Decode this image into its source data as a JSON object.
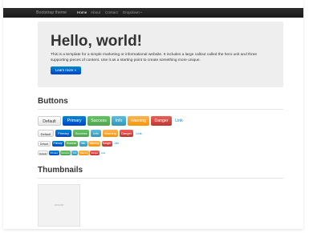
{
  "navbar": {
    "brand": "Bootstrap theme",
    "items": [
      {
        "label": "Home",
        "active": true
      },
      {
        "label": "About",
        "active": false
      },
      {
        "label": "Contact",
        "active": false
      },
      {
        "label": "Dropdown",
        "active": false
      }
    ]
  },
  "hero": {
    "title": "Hello, world!",
    "text": "This is a template for a simple marketing or informational website. It includes a large callout called the hero unit and three supporting pieces of content. Use it as a starting point to create something more unique.",
    "button": "Learn more »"
  },
  "sections": {
    "buttons_title": "Buttons",
    "thumbnails_title": "Thumbnails"
  },
  "buttons": {
    "default": "Default",
    "primary": "Primary",
    "success": "Success",
    "info": "Info",
    "warning": "Warning",
    "danger": "Danger",
    "link": "Link"
  },
  "thumbnail": {
    "label": "200x200"
  },
  "colors": {
    "navbar": "#222222",
    "hero_bg": "#eeeeee",
    "primary": "#0055cc",
    "success": "#5bb75b",
    "info": "#49afcd",
    "warning": "#faa732",
    "danger": "#da4f49",
    "link": "#0088cc"
  }
}
